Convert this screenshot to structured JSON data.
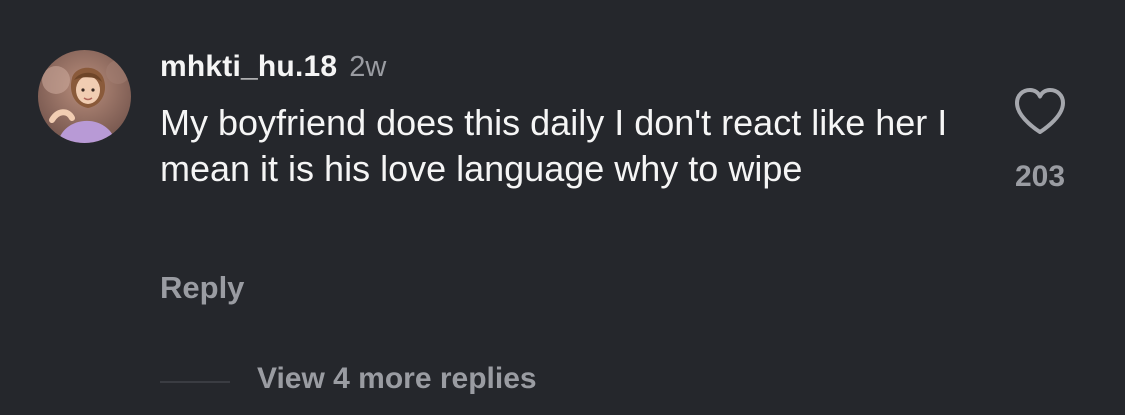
{
  "comment": {
    "username": "mhkti_hu.18",
    "timestamp": "2w",
    "text": "My boyfriend does this daily I don't react like her I mean it is his love language why to wipe",
    "avatar_icon": "profile-avatar",
    "like_icon": "heart-outline-icon",
    "like_count": "203",
    "reply_label": "Reply",
    "view_replies_label": "View 4 more replies"
  },
  "colors": {
    "background": "#25272c",
    "primary_text": "#f5f5f5",
    "secondary_text": "#9a9ca2",
    "divider": "#3a3c42"
  }
}
